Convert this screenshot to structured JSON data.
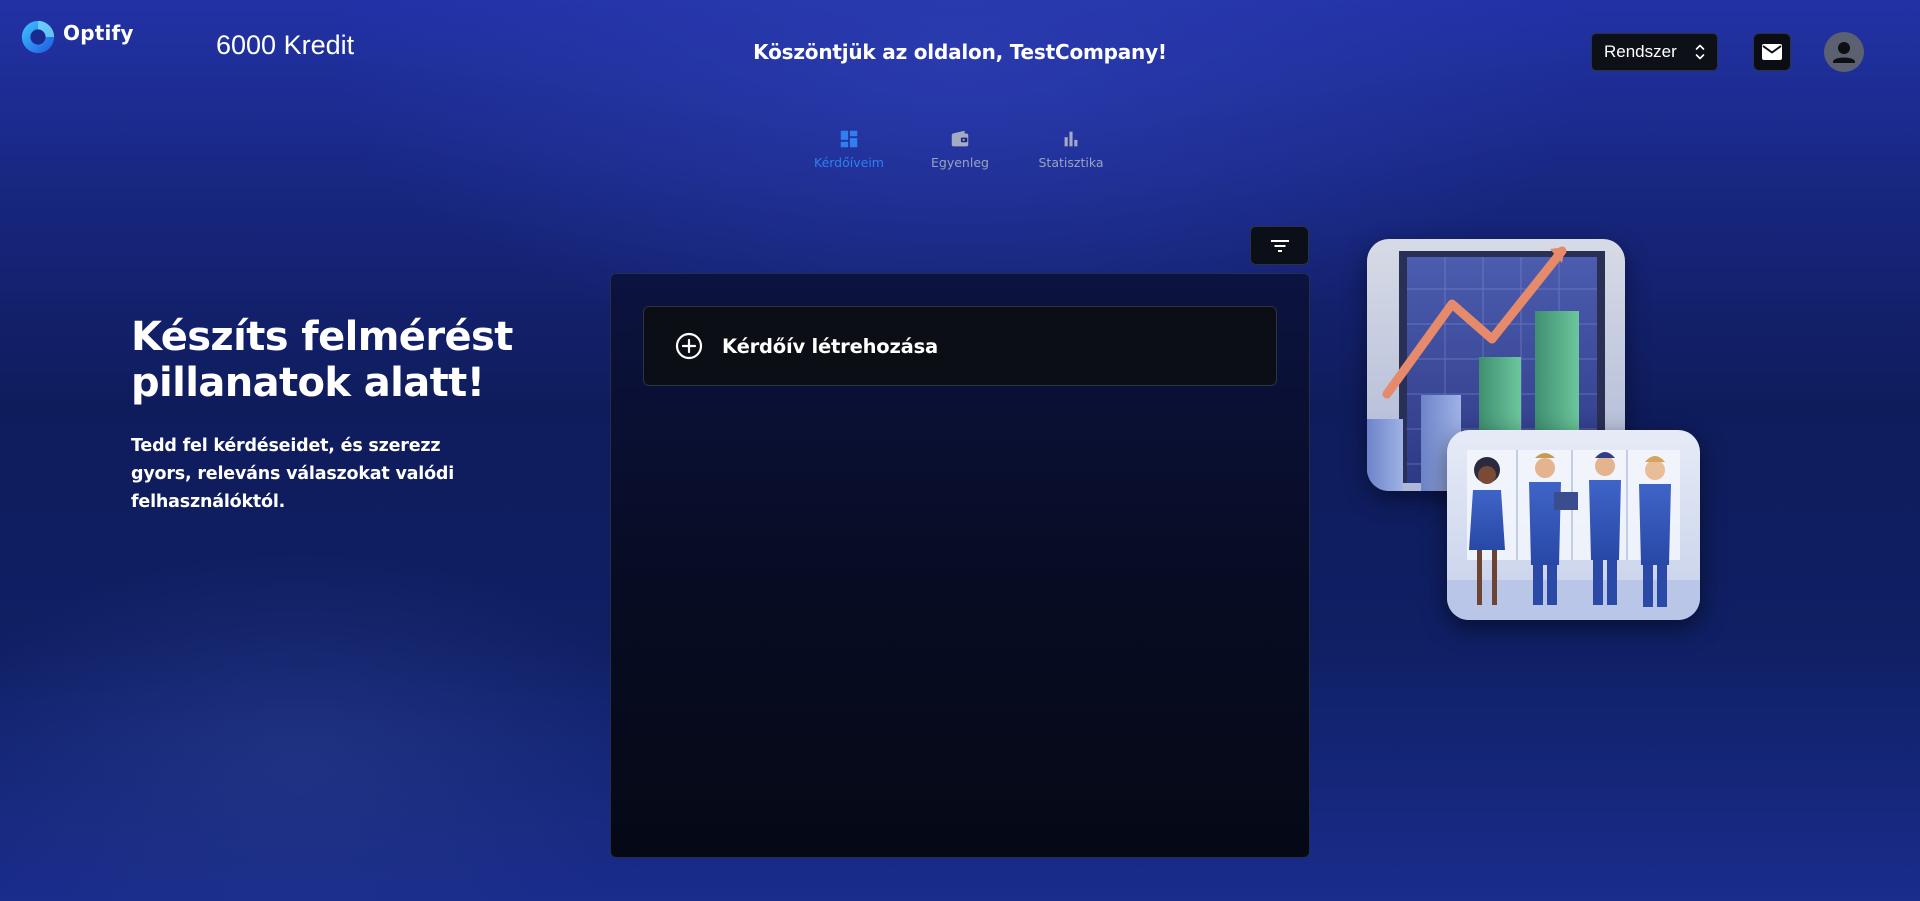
{
  "brand": {
    "name": "Optify",
    "accent": "#2f7ff1"
  },
  "header": {
    "credit": "6000 Kredit",
    "welcome": "Köszöntjük az oldalon, TestCompany!",
    "system_select": {
      "value": "Rendszer"
    },
    "icons": {
      "mail": "mail-icon",
      "profile": "person-icon",
      "select": "unfold-icon"
    }
  },
  "tabs": [
    {
      "label": "Kérdőíveim",
      "icon": "dashboard-icon",
      "active": true
    },
    {
      "label": "Egyenleg",
      "icon": "wallet-icon",
      "active": false
    },
    {
      "label": "Statisztika",
      "icon": "bar-chart-icon",
      "active": false
    }
  ],
  "hero": {
    "title": "Készíts felmérést pillanatok alatt!",
    "subtitle": "Tedd fel kérdéseidet, és szerezz gyors, releváns válaszokat valódi felhasználóktól."
  },
  "surveys": {
    "filter_icon": "filter-icon",
    "create_label": "Kérdőív létrehozása",
    "create_icon": "add-circle-icon"
  }
}
